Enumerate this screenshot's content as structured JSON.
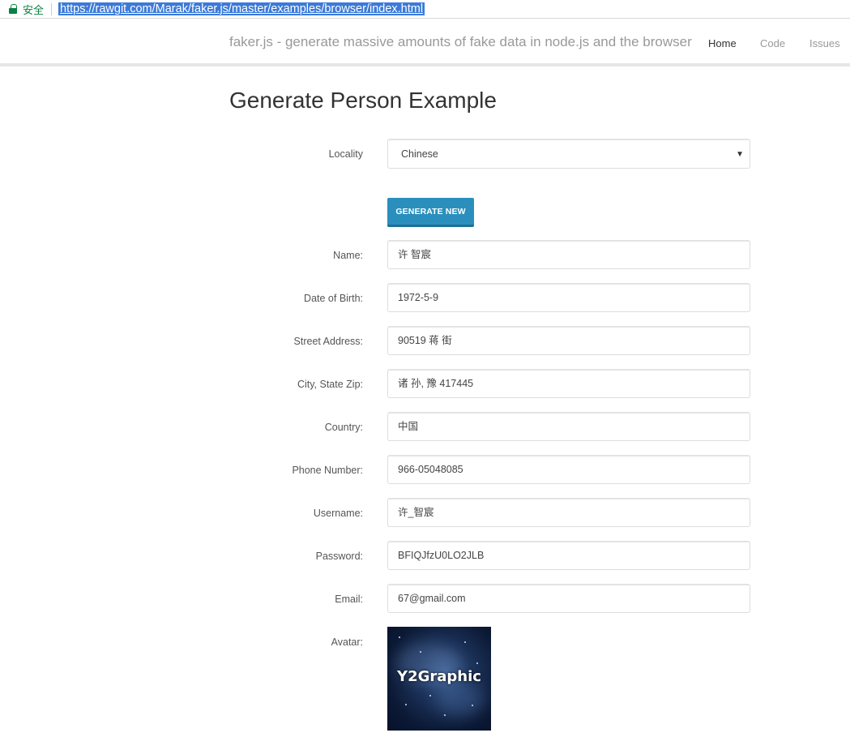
{
  "browser": {
    "secure_label": "安全",
    "url": "https://rawgit.com/Marak/faker.js/master/examples/browser/index.html"
  },
  "navbar": {
    "brand": "faker.js - generate massive amounts of fake data in node.js and the browser",
    "links": [
      {
        "label": "Home",
        "active": true
      },
      {
        "label": "Code",
        "active": false
      },
      {
        "label": "Issues",
        "active": false
      }
    ]
  },
  "page_title": "Generate Person Example",
  "locality": {
    "label": "Locality",
    "value": "Chinese"
  },
  "generate_button": "GENERATE NEW",
  "fields": [
    {
      "label": "Name:",
      "value": "许 智宸"
    },
    {
      "label": "Date of Birth:",
      "value": "1972-5-9"
    },
    {
      "label": "Street Address:",
      "value": "90519 蒋 街"
    },
    {
      "label": "City, State Zip:",
      "value": "诸 孙, 豫 417445"
    },
    {
      "label": "Country:",
      "value": "中国"
    },
    {
      "label": "Phone Number:",
      "value": "966-05048085"
    },
    {
      "label": "Username:",
      "value": "许_智宸"
    },
    {
      "label": "Password:",
      "value": "BFIQJfzU0LO2JLB"
    },
    {
      "label": "Email:",
      "value": "67@gmail.com"
    }
  ],
  "avatar": {
    "label": "Avatar:",
    "image_text": "Y2Graphic"
  }
}
